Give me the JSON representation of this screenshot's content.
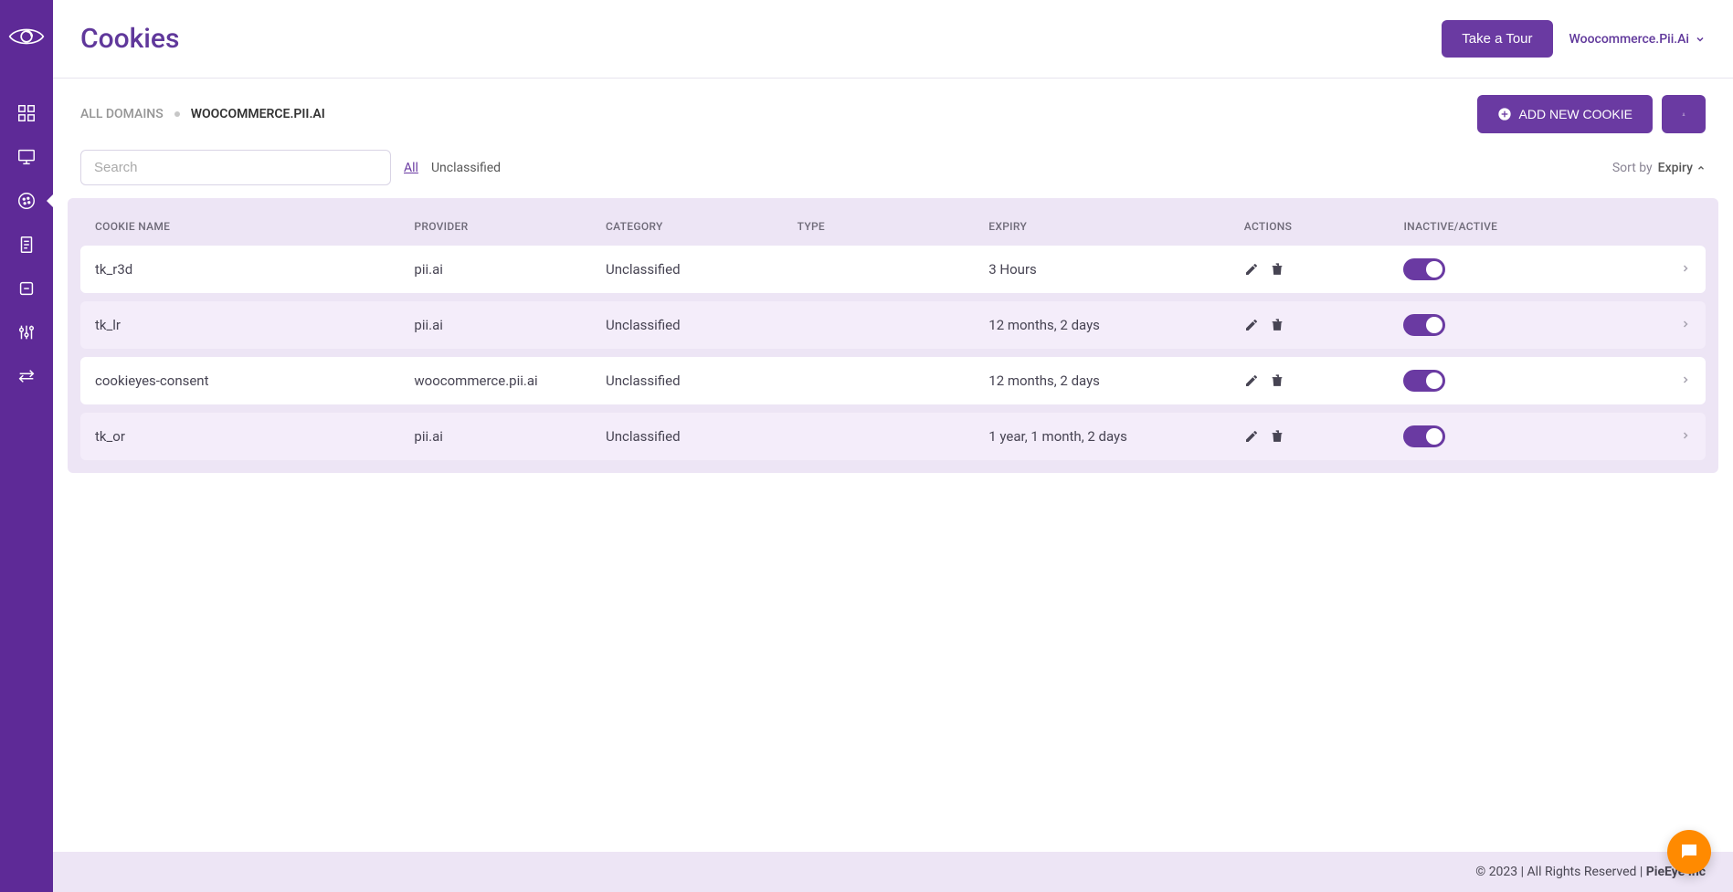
{
  "header": {
    "title": "Cookies",
    "tour_btn": "Take a Tour",
    "domain_selector": "Woocommerce.Pii.Ai"
  },
  "breadcrumb": {
    "all": "ALL DOMAINS",
    "current": "WOOCOMMERCE.PII.AI"
  },
  "toolbar": {
    "add_btn": "ADD NEW COOKIE"
  },
  "filters": {
    "search_placeholder": "Search",
    "all": "All",
    "unclassified": "Unclassified",
    "sort_label": "Sort by",
    "sort_value": "Expiry"
  },
  "columns": {
    "name": "COOKIE NAME",
    "provider": "PROVIDER",
    "category": "CATEGORY",
    "type": "TYPE",
    "expiry": "EXPIRY",
    "actions": "ACTIONS",
    "toggle": "INACTIVE/ACTIVE"
  },
  "rows": [
    {
      "name": "tk_r3d",
      "provider": "pii.ai",
      "category": "Unclassified",
      "type": "",
      "expiry": "3 Hours",
      "active": true
    },
    {
      "name": "tk_lr",
      "provider": "pii.ai",
      "category": "Unclassified",
      "type": "",
      "expiry": "12 months, 2 days",
      "active": true
    },
    {
      "name": "cookieyes-consent",
      "provider": "woocommerce.pii.ai",
      "category": "Unclassified",
      "type": "",
      "expiry": "12 months, 2 days",
      "active": true
    },
    {
      "name": "tk_or",
      "provider": "pii.ai",
      "category": "Unclassified",
      "type": "",
      "expiry": "1 year, 1 month, 2 days",
      "active": true
    }
  ],
  "footer": {
    "text": "© 2023 | All Rights Reserved | ",
    "brand": "PieEye Inc"
  }
}
